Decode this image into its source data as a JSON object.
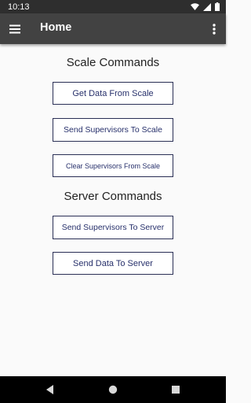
{
  "status_bar": {
    "time": "10:13",
    "icons": [
      "wifi-icon",
      "signal-icon",
      "battery-icon"
    ]
  },
  "app_bar": {
    "title": "Home",
    "left_icon": "menu-icon",
    "right_icon": "more-vert-icon"
  },
  "scale_section": {
    "title": "Scale Commands",
    "buttons": [
      {
        "label": "Get Data From Scale"
      },
      {
        "label": "Send Supervisors To Scale"
      },
      {
        "label": "Clear Supervisors From Scale"
      }
    ]
  },
  "server_section": {
    "title": "Server Commands",
    "buttons": [
      {
        "label": "Send Supervisors To Server"
      },
      {
        "label": "Send Data To Server"
      }
    ]
  },
  "nav_bar": {
    "icons": [
      "back-icon",
      "home-icon",
      "recents-icon"
    ]
  },
  "colors": {
    "status_bar": "#2e2e2e",
    "app_bar": "#424242",
    "background": "#fafafa",
    "button_border": "#2a2f55",
    "button_text": "#27306b"
  }
}
